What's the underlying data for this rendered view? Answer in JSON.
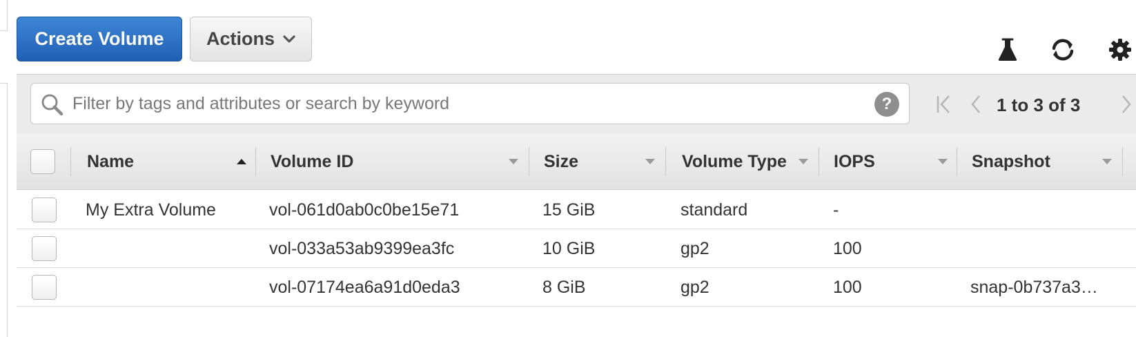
{
  "toolbar": {
    "create_label": "Create Volume",
    "actions_label": "Actions",
    "icons": [
      "flask-icon",
      "refresh-icon",
      "gear-icon"
    ]
  },
  "filter": {
    "placeholder": "Filter by tags and attributes or search by keyword",
    "help_glyph": "?",
    "pager_text": "1 to 3 of 3"
  },
  "table": {
    "columns": [
      "Name",
      "Volume ID",
      "Size",
      "Volume Type",
      "IOPS",
      "Snapshot"
    ],
    "sorted_column": "Name",
    "sort_direction": "ascending",
    "rows": [
      {
        "name": "My Extra Volume",
        "volume_id": "vol-061d0ab0c0be15e71",
        "size": "15 GiB",
        "type": "standard",
        "iops": "-",
        "snapshot": ""
      },
      {
        "name": "",
        "volume_id": "vol-033a53ab9399ea3fc",
        "size": "10 GiB",
        "type": "gp2",
        "iops": "100",
        "snapshot": ""
      },
      {
        "name": "",
        "volume_id": "vol-07174ea6a91d0eda3",
        "size": "8 GiB",
        "type": "gp2",
        "iops": "100",
        "snapshot": "snap-0b737a3…"
      }
    ]
  },
  "colors": {
    "primary_button": "#2a6ec2",
    "header_bg": "#e8e8e8",
    "text": "#333333"
  }
}
